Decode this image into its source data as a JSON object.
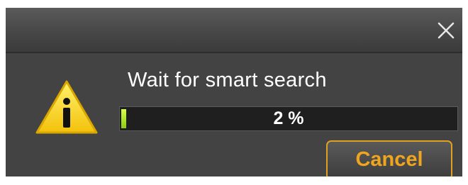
{
  "dialog": {
    "message": "Wait for smart search",
    "progress": {
      "value": 2,
      "label": "2 %"
    },
    "cancel_label": "Cancel",
    "icons": {
      "close": "close-icon",
      "warning": "warning-icon"
    },
    "colors": {
      "accent": "#f0a51e",
      "progress_fill": "#9ad61e",
      "background": "#434343"
    }
  }
}
